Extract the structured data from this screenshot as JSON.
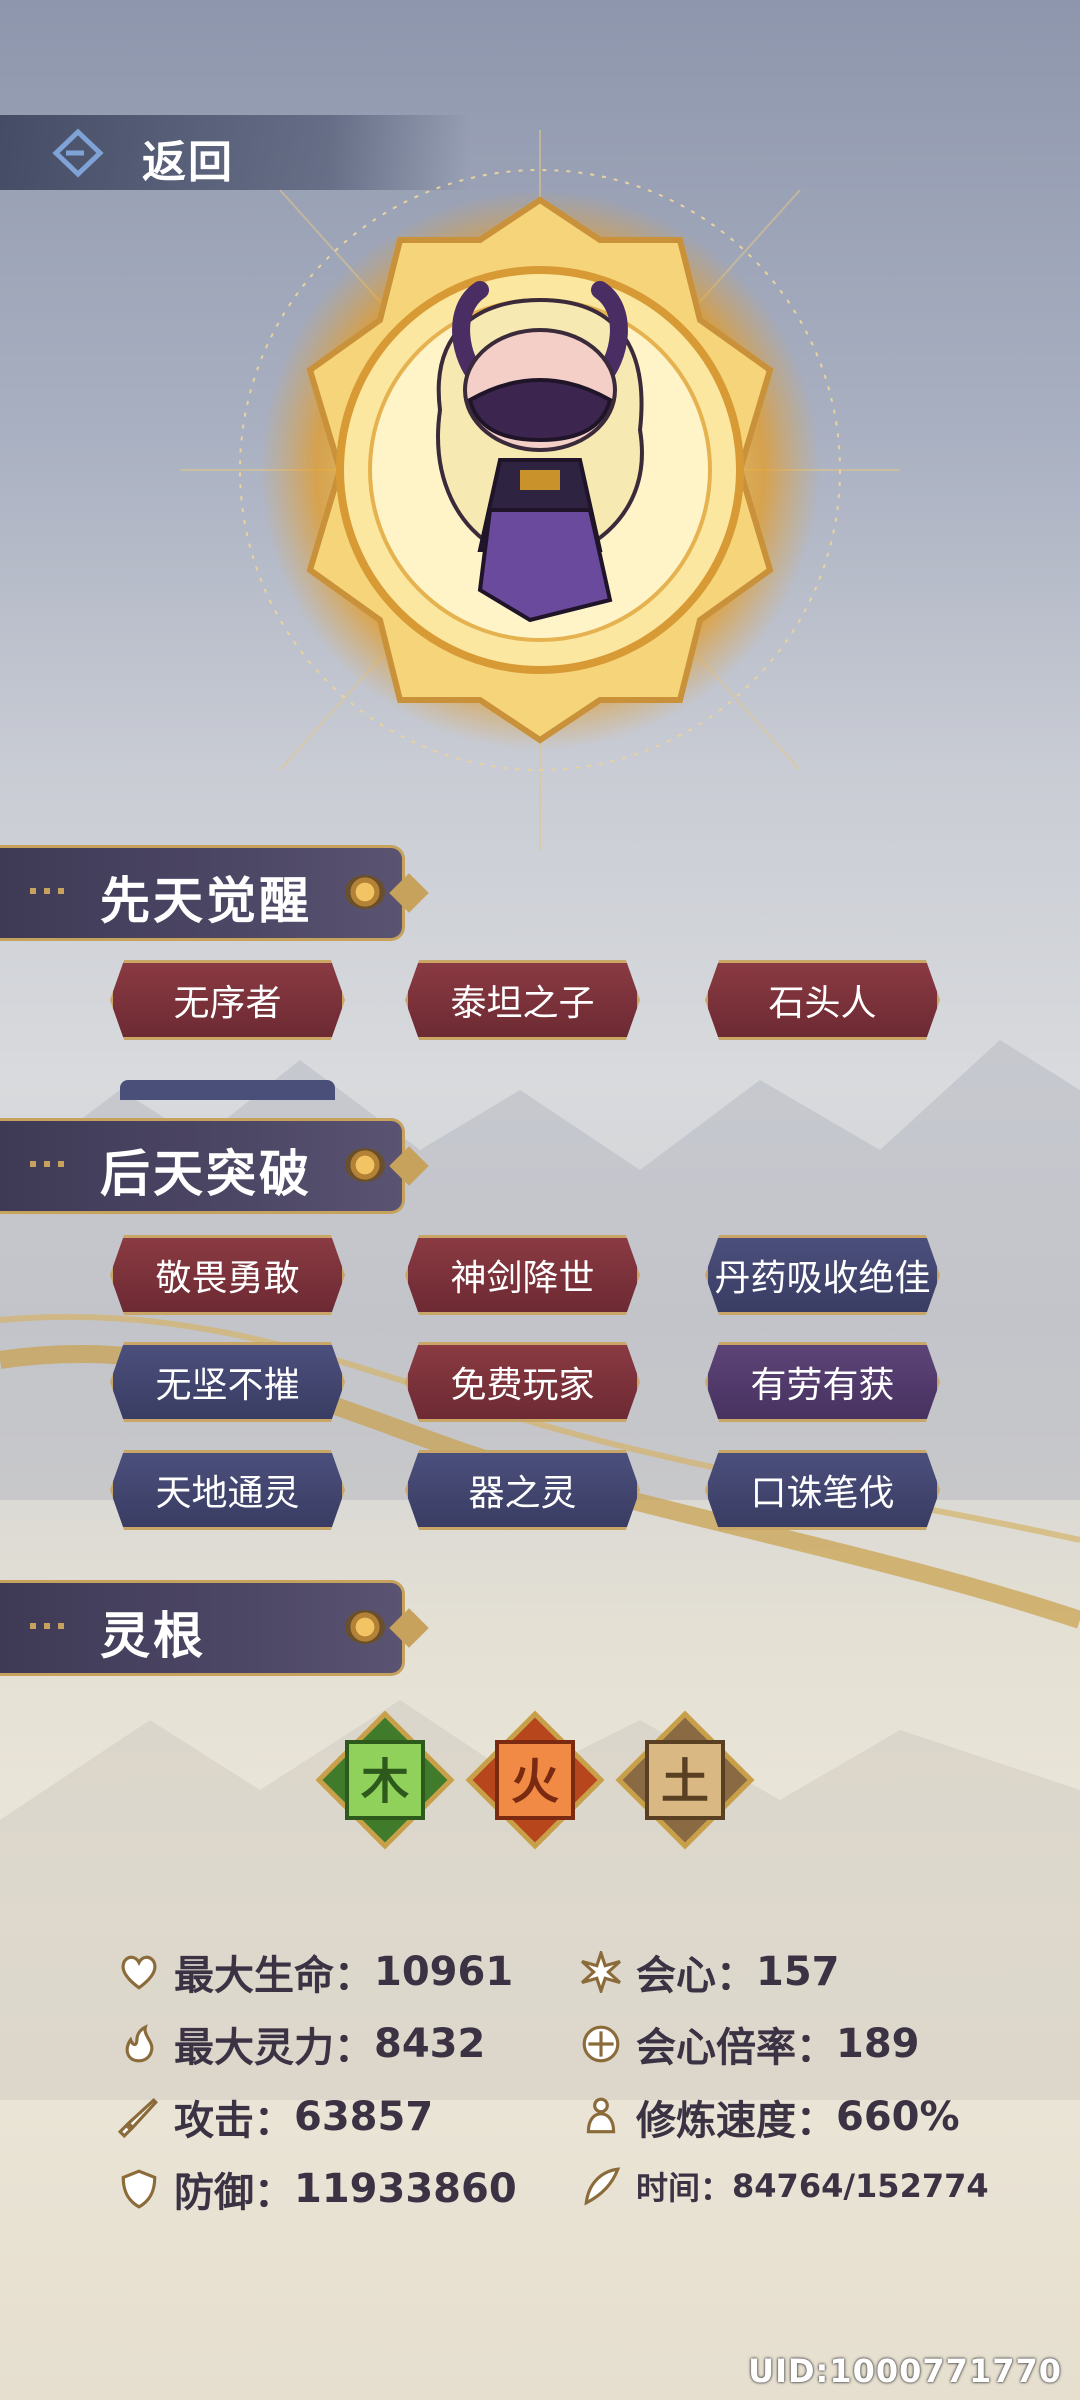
{
  "nav": {
    "back_label": "返回"
  },
  "sections": {
    "innate": {
      "title": "先天觉醒",
      "tags": [
        {
          "label": "无序者",
          "style": "red"
        },
        {
          "label": "泰坦之子",
          "style": "red"
        },
        {
          "label": "石头人",
          "style": "red"
        }
      ]
    },
    "acquired": {
      "title": "后天突破",
      "tags": [
        {
          "label": "敬畏勇敢",
          "style": "red"
        },
        {
          "label": "神剑降世",
          "style": "red"
        },
        {
          "label": "丹药吸收绝佳",
          "style": "blue"
        },
        {
          "label": "无坚不摧",
          "style": "blue"
        },
        {
          "label": "免费玩家",
          "style": "red"
        },
        {
          "label": "有劳有获",
          "style": "purple"
        },
        {
          "label": "天地通灵",
          "style": "blue"
        },
        {
          "label": "器之灵",
          "style": "blue"
        },
        {
          "label": "口诛笔伐",
          "style": "blue"
        }
      ]
    },
    "spirit_root": {
      "title": "灵根",
      "roots": [
        {
          "char": "木",
          "color": "#5aa83a"
        },
        {
          "char": "火",
          "color": "#d9642a"
        },
        {
          "char": "土",
          "color": "#a8865a"
        }
      ]
    }
  },
  "stats": {
    "max_hp": {
      "label": "最大生命：",
      "value": "10961",
      "icon": "heart-icon"
    },
    "max_mana": {
      "label": "最大灵力：",
      "value": "8432",
      "icon": "flame-icon"
    },
    "attack": {
      "label": "攻击：",
      "value": "63857",
      "icon": "sword-icon"
    },
    "defense": {
      "label": "防御：",
      "value": "11933860",
      "icon": "shield-icon"
    },
    "crit": {
      "label": "会心：",
      "value": "157",
      "icon": "burst-icon"
    },
    "crit_rate": {
      "label": "会心倍率：",
      "value": "189",
      "icon": "orb-icon"
    },
    "cultivation_speed": {
      "label": "修炼速度：",
      "value": "660%",
      "icon": "meditate-icon"
    },
    "time": {
      "label": "时间：",
      "value": "84764/152774",
      "icon": "feather-icon"
    }
  },
  "footer": {
    "uid": "UID:1000771770"
  },
  "colors": {
    "gold": "#c7a25c",
    "header_bg": "#453f5e",
    "tag_red": "#7a323b",
    "tag_blue": "#42466f",
    "tag_purple": "#523a6c"
  }
}
